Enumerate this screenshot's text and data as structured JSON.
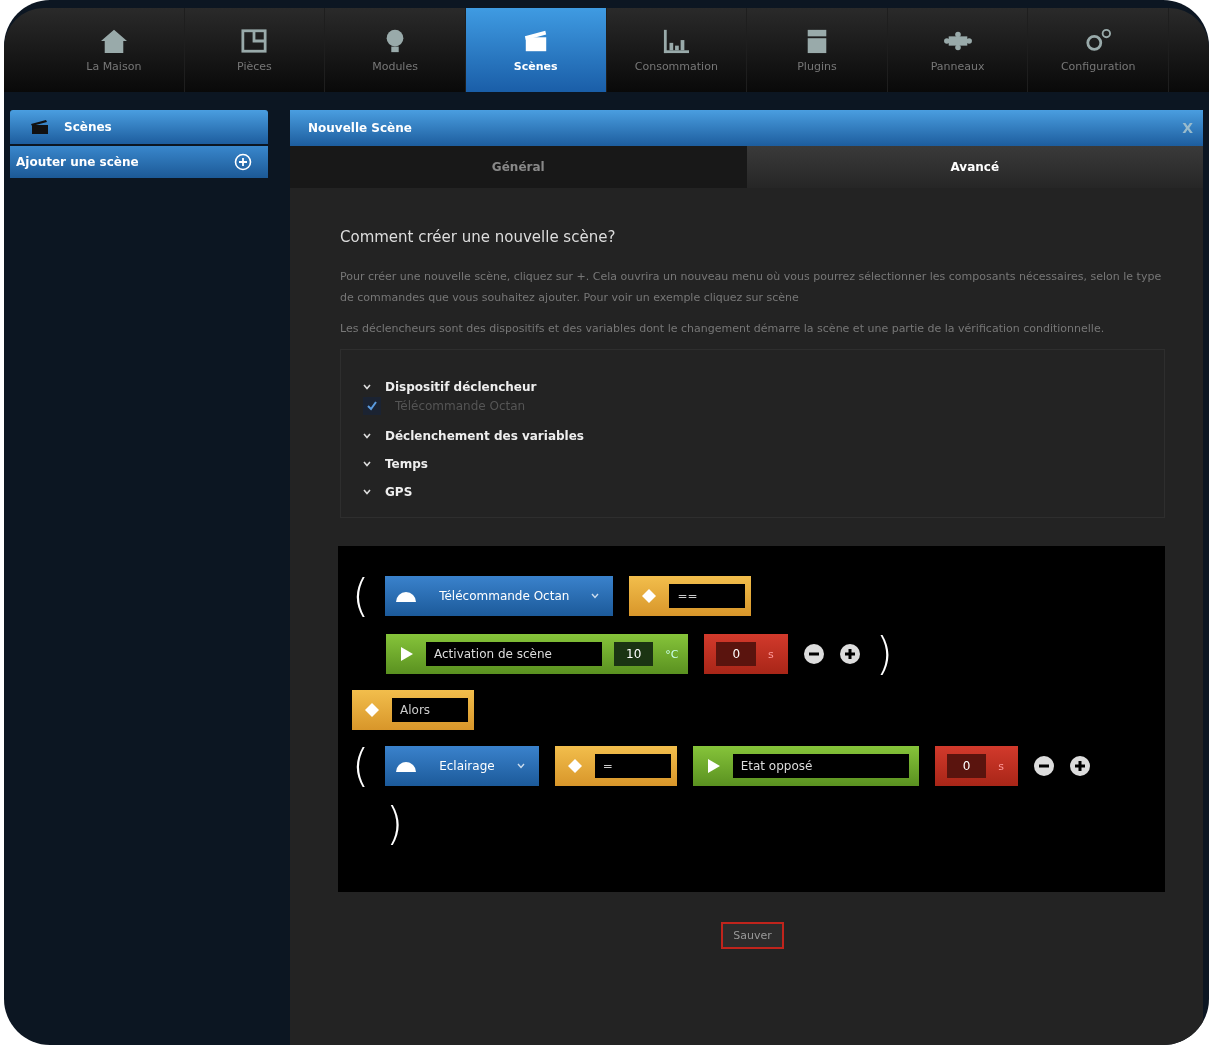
{
  "nav": [
    {
      "label": "La Maison",
      "kind": "house",
      "selected": false
    },
    {
      "label": "Pièces",
      "kind": "rooms",
      "selected": false
    },
    {
      "label": "Modules",
      "kind": "bulb",
      "selected": false
    },
    {
      "label": "Scènes",
      "kind": "clapper",
      "selected": true
    },
    {
      "label": "Consommation",
      "kind": "chart",
      "selected": false
    },
    {
      "label": "Plugins",
      "kind": "box",
      "selected": false
    },
    {
      "label": "Panneaux",
      "kind": "puzzle",
      "selected": false
    },
    {
      "label": "Configuration",
      "kind": "gears",
      "selected": false
    }
  ],
  "sidebar": {
    "title": "Scènes",
    "items": [
      {
        "label": "Ajouter une scène"
      }
    ]
  },
  "panel": {
    "title": "Nouvelle Scène",
    "close": "X",
    "tabs": [
      {
        "label": "Général",
        "selected": false
      },
      {
        "label": "Avancé",
        "selected": true
      }
    ],
    "heading": "Comment créer une nouvelle scène?",
    "paragraphs": [
      "Pour créer une nouvelle scène, cliquez sur +. Cela ouvrira un nouveau menu où vous pourrez sélectionner les composants nécessaires, selon le type de commandes que vous souhaitez ajouter. Pour voir un exemple cliquez sur scène",
      "Les déclencheurs sont des dispositifs et des variables dont le changement démarre la scène et une partie de la vérification conditionnelle."
    ],
    "triggers": [
      {
        "title": "Dispositif déclencheur",
        "children": [
          {
            "label": "Télécommande Octan",
            "checked": true
          }
        ]
      },
      {
        "title": "Déclenchement des variables"
      },
      {
        "title": "Temps"
      },
      {
        "title": "GPS"
      }
    ],
    "editor": [
      {
        "kind": "top",
        "items": [
          {
            "kind": "paren",
            "text": "("
          },
          {
            "kind": "device",
            "label": "Télécommande Octan"
          },
          {
            "kind": "operator",
            "value": "=="
          }
        ]
      },
      {
        "kind": "nested",
        "items": [
          {
            "kind": "action",
            "label": "Activation de scène",
            "value": "10",
            "unit": "°C"
          },
          {
            "kind": "delay",
            "value": "0",
            "unit": "s"
          },
          {
            "kind": "remove"
          },
          {
            "kind": "add"
          },
          {
            "kind": "paren",
            "text": ")"
          }
        ]
      },
      {
        "kind": "top",
        "items": [
          {
            "kind": "operator",
            "value": "Alors"
          }
        ]
      },
      {
        "kind": "top",
        "items": [
          {
            "kind": "paren",
            "text": "("
          },
          {
            "kind": "device",
            "label": "Eclairage"
          },
          {
            "kind": "operator",
            "value": "="
          },
          {
            "kind": "action",
            "label": "Etat opposé"
          },
          {
            "kind": "delay",
            "value": "0",
            "unit": "s"
          },
          {
            "kind": "remove"
          },
          {
            "kind": "add"
          }
        ]
      },
      {
        "kind": "nested",
        "items": [
          {
            "kind": "paren",
            "text": ")"
          }
        ]
      }
    ],
    "save": "Sauver"
  }
}
